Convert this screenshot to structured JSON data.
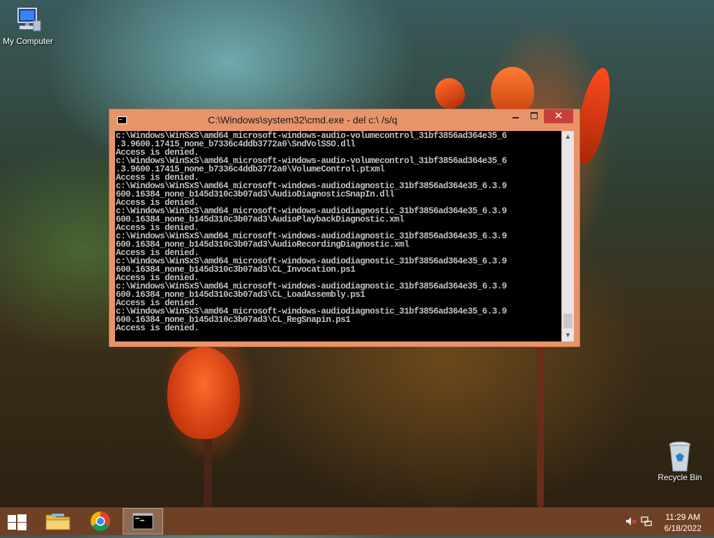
{
  "desktop": {
    "icons": [
      {
        "label": "My Computer"
      },
      {
        "label": "Recycle Bin"
      }
    ]
  },
  "window": {
    "title": "C:\\Windows\\system32\\cmd.exe - del  c:\\ /s/q",
    "close_glyph": "✕",
    "console_text": "c:\\Windows\\WinSxS\\amd64_microsoft-windows-audio-volumecontrol_31bf3856ad364e35_6\n.3.9600.17415_none_b7336c4ddb3772a0\\SndVolSSO.dll\nAccess is denied.\nc:\\Windows\\WinSxS\\amd64_microsoft-windows-audio-volumecontrol_31bf3856ad364e35_6\n.3.9600.17415_none_b7336c4ddb3772a0\\VolumeControl.ptxml\nAccess is denied.\nc:\\Windows\\WinSxS\\amd64_microsoft-windows-audiodiagnostic_31bf3856ad364e35_6.3.9\n600.16384_none_b145d310c3b07ad3\\AudioDiagnosticSnapIn.dll\nAccess is denied.\nc:\\Windows\\WinSxS\\amd64_microsoft-windows-audiodiagnostic_31bf3856ad364e35_6.3.9\n600.16384_none_b145d310c3b07ad3\\AudioPlaybackDiagnostic.xml\nAccess is denied.\nc:\\Windows\\WinSxS\\amd64_microsoft-windows-audiodiagnostic_31bf3856ad364e35_6.3.9\n600.16384_none_b145d310c3b07ad3\\AudioRecordingDiagnostic.xml\nAccess is denied.\nc:\\Windows\\WinSxS\\amd64_microsoft-windows-audiodiagnostic_31bf3856ad364e35_6.3.9\n600.16384_none_b145d310c3b07ad3\\CL_Invocation.ps1\nAccess is denied.\nc:\\Windows\\WinSxS\\amd64_microsoft-windows-audiodiagnostic_31bf3856ad364e35_6.3.9\n600.16384_none_b145d310c3b07ad3\\CL_LoadAssembly.ps1\nAccess is denied.\nc:\\Windows\\WinSxS\\amd64_microsoft-windows-audiodiagnostic_31bf3856ad364e35_6.3.9\n600.16384_none_b145d310c3b07ad3\\CL_RegSnapin.ps1\nAccess is denied."
  },
  "taskbar": {
    "apps": [
      {
        "icon": "file-explorer-icon"
      },
      {
        "icon": "chrome-icon"
      },
      {
        "icon": "command-prompt-icon",
        "active": true
      }
    ],
    "clock": {
      "time": "11:29 AM",
      "date": "6/18/2022"
    }
  },
  "colors": {
    "window_frame": "#e8946a",
    "close_button": "#c7413a",
    "console_bg": "#000000",
    "console_text": "#c0c0c0"
  }
}
